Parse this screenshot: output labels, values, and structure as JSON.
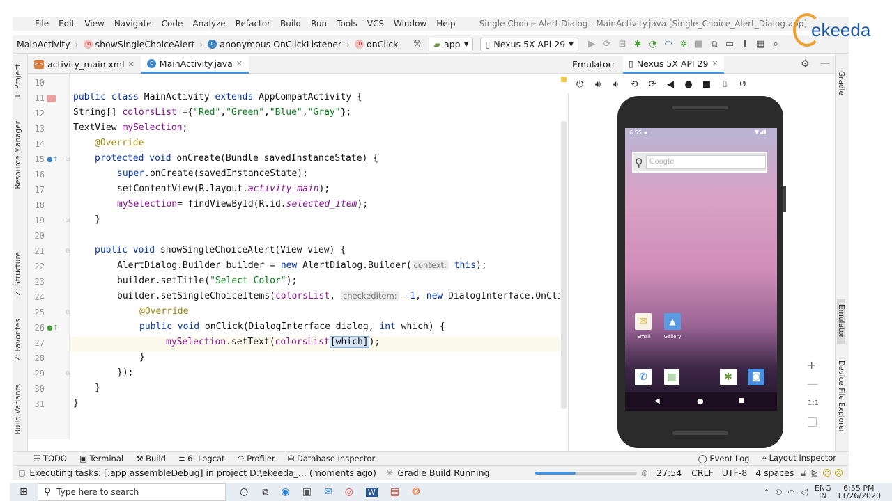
{
  "menu": {
    "items": [
      "File",
      "Edit",
      "View",
      "Navigate",
      "Code",
      "Analyze",
      "Refactor",
      "Build",
      "Run",
      "Tools",
      "VCS",
      "Window",
      "Help"
    ],
    "window_title": "Single Choice Alert Dialog - MainActivity.java [Single_Choice_Alert_Dialog.app]"
  },
  "breadcrumb": {
    "class_name": "MainActivity",
    "method_name": "showSingleChoiceAlert",
    "listener_name": "anonymous OnClickListener",
    "callback_name": "onClick"
  },
  "toolbar": {
    "run_config": "app",
    "device": "Nexus 5X API 29"
  },
  "tabs": [
    {
      "label": "activity_main.xml"
    },
    {
      "label": "MainActivity.java"
    }
  ],
  "editor": {
    "line_numbers": [
      "10",
      "11",
      "12",
      "13",
      "14",
      "15",
      "16",
      "17",
      "18",
      "19",
      "20",
      "21",
      "22",
      "23",
      "24",
      "25",
      "26",
      "27",
      "28",
      "29",
      "30",
      "31"
    ],
    "lines": {
      "l11_a": "public class ",
      "l11_b": "MainActivity ",
      "l11_c": "extends ",
      "l11_d": "AppCompatActivity {",
      "l12_a": "String[] ",
      "l12_b": "colorsList ",
      "l12_c": "={",
      "l12_d": "\"Red\"",
      "l12_e": ",",
      "l12_f": "\"Green\"",
      "l12_g": ",",
      "l12_h": "\"Blue\"",
      "l12_i": ",",
      "l12_j": "\"Gray\"",
      "l12_k": "};",
      "l13_a": "TextView ",
      "l13_b": "mySelection",
      "l13_c": ";",
      "l14": "@Override",
      "l15_a": "protected void ",
      "l15_b": "onCreate(Bundle savedInstanceState) {",
      "l16_a": "super",
      "l16_b": ".onCreate(savedInstanceState);",
      "l17_a": "setContentView(R.layout.",
      "l17_b": "activity_main",
      "l17_c": ");",
      "l18_a": "mySelection",
      "l18_b": "= findViewById(R.id.",
      "l18_c": "selected_item",
      "l18_d": ");",
      "l19": "}",
      "l21_a": "public void ",
      "l21_b": "showSingleChoiceAlert(View view) {",
      "l22_a": "AlertDialog.Builder builder = ",
      "l22_b": "new ",
      "l22_c": "AlertDialog.Builder(",
      "l22_hint": "context:",
      "l22_d": " this",
      "l22_e": ");",
      "l23_a": "builder.setTitle(",
      "l23_b": "\"Select Color\"",
      "l23_c": ");",
      "l24_a": "builder.setSingleChoiceItems(",
      "l24_b": "colorsList",
      "l24_c": ", ",
      "l24_hint": "checkedItem:",
      "l24_d": " -1",
      "l24_e": ", ",
      "l24_f": "new ",
      "l24_g": "DialogInterface.OnClic",
      "l25": "@Override",
      "l26_a": "public void ",
      "l26_b": "onClick(DialogInterface dialog, ",
      "l26_c": "int ",
      "l26_d": "which) {",
      "l27_a": "mySelection",
      "l27_b": ".setText(",
      "l27_c": "colorsList",
      "l27_d": "[which]",
      "l27_e": ");",
      "l28": "}",
      "l29": "});",
      "l30": "}",
      "l31": "}"
    }
  },
  "emulator": {
    "label": "Emulator:",
    "tab": "Nexus 5X API 29",
    "time": "6:55",
    "search_placeholder": "Google",
    "apps": [
      "Email",
      "Gallery"
    ],
    "zoom_label": "1:1"
  },
  "side_tabs": {
    "left": [
      "1: Project",
      "Resource Manager",
      "Z: Structure",
      "2: Favorites",
      "Build Variants"
    ],
    "right": [
      "Gradle",
      "Emulator",
      "Device File Explorer"
    ]
  },
  "tool_windows": [
    "TODO",
    "Terminal",
    "Build",
    "6: Logcat",
    "Profiler",
    "Database Inspector"
  ],
  "tool_windows_right": [
    "Event Log",
    "Layout Inspector"
  ],
  "status": {
    "message": "Executing tasks: [:app:assembleDebug] in project D:\\ekeeda_... (moments ago)",
    "build": "Gradle Build Running",
    "position": "27:54",
    "line_sep": "CRLF",
    "encoding": "UTF-8",
    "indent": "4 spaces"
  },
  "taskbar": {
    "search_placeholder": "Type here to search",
    "lang": "ENG",
    "region": "IN",
    "time": "6:55 PM",
    "date": "11/26/2020"
  },
  "watermark": "ekeeda"
}
